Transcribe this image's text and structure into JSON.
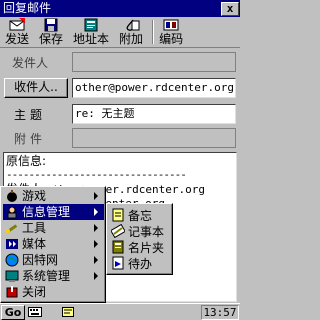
{
  "window": {
    "title": "回复邮件",
    "close_label": "x"
  },
  "toolbar": {
    "send": "发送",
    "save": "保存",
    "address_book": "地址本",
    "attach": "附加",
    "encoding": "编码"
  },
  "form": {
    "sender_label": "发件人",
    "sender_value": "",
    "recipients_button": "收件人..",
    "recipients_value": "other@power.rdcenter.org",
    "subject_label": "主题",
    "subject_value": "re: 无主题",
    "attachment_label": "附件",
    "attachment_value": ""
  },
  "body": {
    "line1": "原信息:",
    "line2": "--------------------------------",
    "line3_prefix": "发件人",
    "line3_value": "other@power.rdcenter.org",
    "line4_value": "other@power.rdcenter.org"
  },
  "start_menu": {
    "items": [
      {
        "label": "游戏",
        "has_sub": true
      },
      {
        "label": "信息管理",
        "has_sub": true
      },
      {
        "label": "工具",
        "has_sub": true
      },
      {
        "label": "媒体",
        "has_sub": true
      },
      {
        "label": "因特网",
        "has_sub": true
      },
      {
        "label": "系统管理",
        "has_sub": true
      },
      {
        "label": "关闭",
        "has_sub": false
      }
    ]
  },
  "submenu": {
    "items": [
      {
        "label": "备忘"
      },
      {
        "label": "记事本"
      },
      {
        "label": "名片夹"
      },
      {
        "label": "待办"
      }
    ]
  },
  "taskbar": {
    "go_label": "Go",
    "time": "13:57"
  },
  "colors": {
    "title_bar": "#000080",
    "selection": "#000080",
    "chrome": "#c0c0c0"
  }
}
